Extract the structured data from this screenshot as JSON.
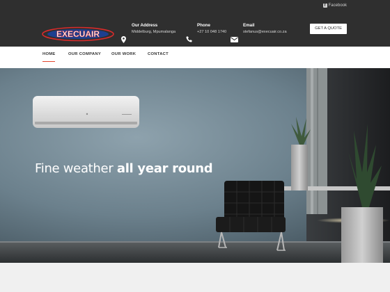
{
  "topbar": {
    "facebook_label": "Facebook"
  },
  "header": {
    "logo_text": "EXECUAIR",
    "address": {
      "title": "Our Address",
      "value": "Middelburg, Mpumalanga"
    },
    "phone": {
      "title": "Phone",
      "value": "+27 10 048 1740"
    },
    "email": {
      "title": "Email",
      "value": "stefanus@execuair.co.za"
    },
    "quote_button": "GET A QUOTE"
  },
  "nav": {
    "items": [
      {
        "label": "HOME",
        "active": true
      },
      {
        "label": "OUR COMPANY"
      },
      {
        "label": "OUR WORK"
      },
      {
        "label": "CONTACT"
      }
    ]
  },
  "hero": {
    "title_light": "Fine weather ",
    "title_bold": "all year round"
  },
  "colors": {
    "header_bg": "#2f2f2f",
    "accent": "#e3452d",
    "wall": "#6f8591"
  }
}
